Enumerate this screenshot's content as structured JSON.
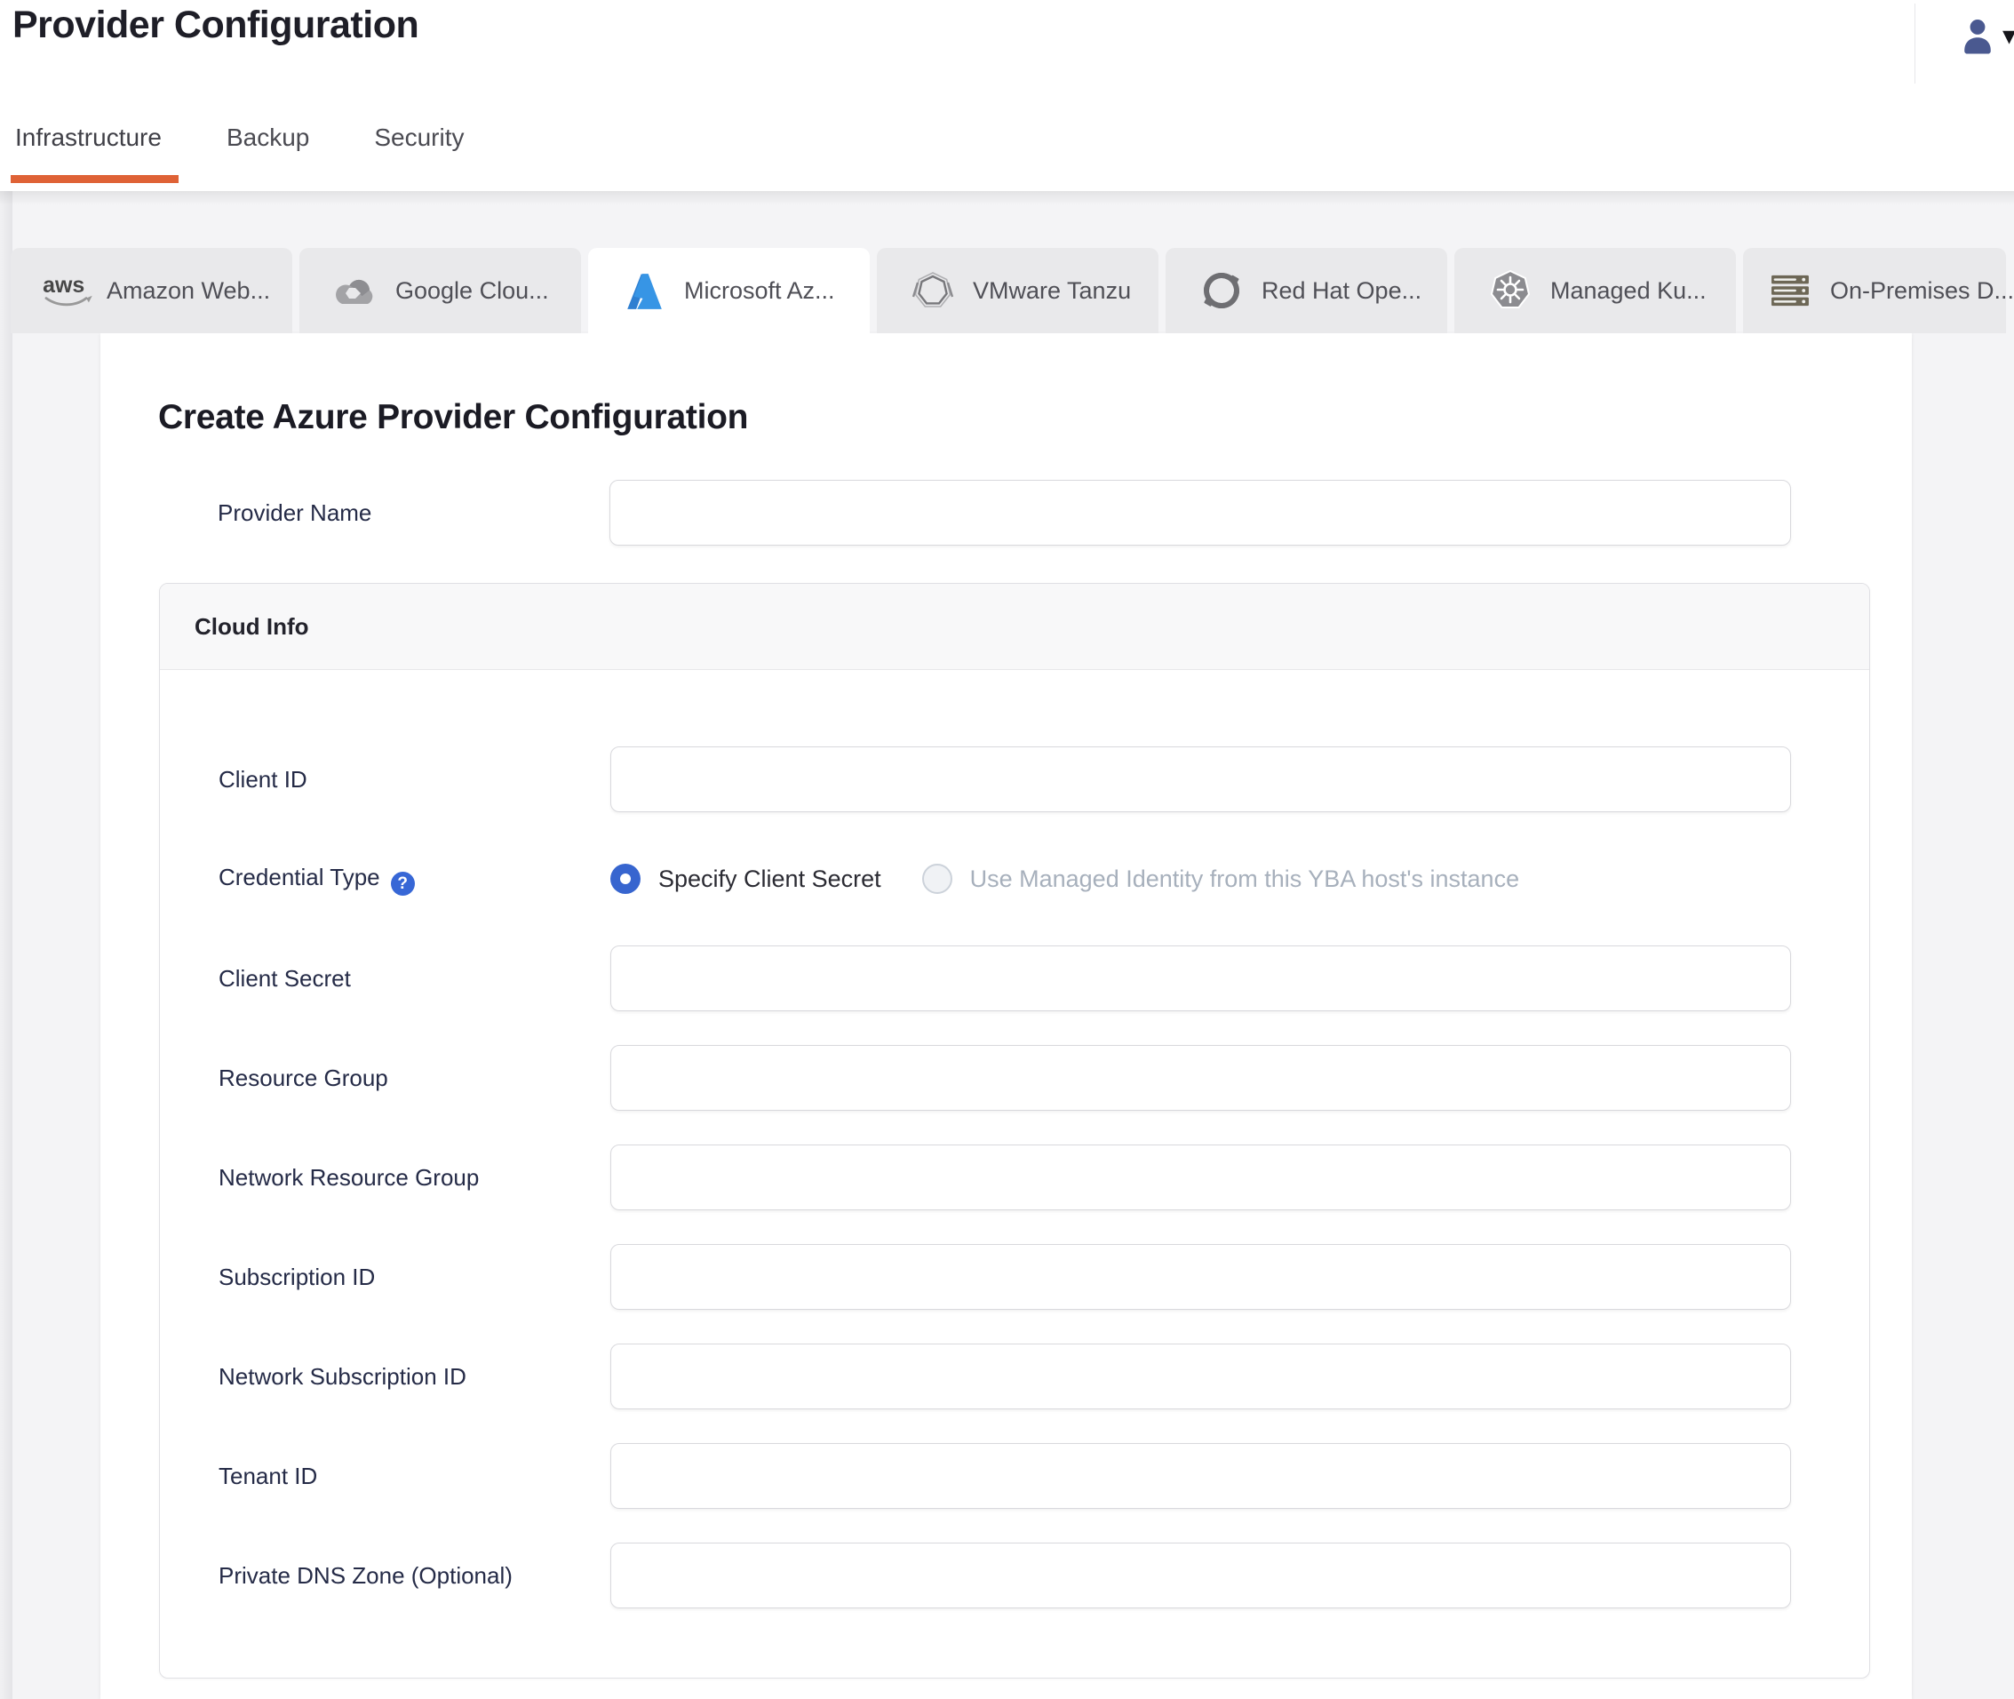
{
  "header": {
    "title": "Provider Configuration",
    "user_menu_caret": "▾"
  },
  "nav_tabs": [
    {
      "label": "Infrastructure",
      "active": true
    },
    {
      "label": "Backup",
      "active": false
    },
    {
      "label": "Security",
      "active": false
    }
  ],
  "provider_tabs": [
    {
      "label": "Amazon Web...",
      "icon": "aws-icon",
      "active": false
    },
    {
      "label": "Google Clou...",
      "icon": "google-cloud-icon",
      "active": false
    },
    {
      "label": "Microsoft Az...",
      "icon": "azure-icon",
      "active": true
    },
    {
      "label": "VMware Tanzu",
      "icon": "vmware-tanzu-icon",
      "active": false
    },
    {
      "label": "Red Hat Ope...",
      "icon": "redhat-openshift-icon",
      "active": false
    },
    {
      "label": "Managed Ku...",
      "icon": "kubernetes-icon",
      "active": false
    },
    {
      "label": "On-Premises D...",
      "icon": "onprem-servers-icon",
      "active": false
    }
  ],
  "form": {
    "heading": "Create Azure Provider Configuration",
    "provider_name": {
      "label": "Provider Name",
      "value": ""
    },
    "cloud_info": {
      "section_title": "Cloud Info",
      "fields": [
        {
          "label": "Client ID",
          "type": "text",
          "value": ""
        },
        {
          "label": "Credential Type",
          "type": "radio-group",
          "has_help_icon": true,
          "help_glyph": "?",
          "options": [
            {
              "label": "Specify Client Secret",
              "selected": true,
              "disabled": false
            },
            {
              "label": "Use Managed Identity from this YBA host's instance",
              "selected": false,
              "disabled": true
            }
          ]
        },
        {
          "label": "Client Secret",
          "type": "text",
          "value": ""
        },
        {
          "label": "Resource Group",
          "type": "text",
          "value": ""
        },
        {
          "label": "Network Resource Group",
          "type": "text",
          "value": ""
        },
        {
          "label": "Subscription ID",
          "type": "text",
          "value": ""
        },
        {
          "label": "Network Subscription ID",
          "type": "text",
          "value": ""
        },
        {
          "label": "Tenant ID",
          "type": "text",
          "value": ""
        },
        {
          "label": "Private DNS Zone (Optional)",
          "type": "text",
          "value": ""
        }
      ]
    }
  },
  "colors": {
    "accent_orange": "#df6236",
    "radio_blue": "#3765cf",
    "help_icon_blue": "#3767d6",
    "azure_blue": "#2f7fd1",
    "user_icon_indigo": "#4a5990",
    "panel_background": "#ffffff",
    "page_background": "#f4f4f6",
    "inactive_tab_background": "#e9e9eb"
  }
}
